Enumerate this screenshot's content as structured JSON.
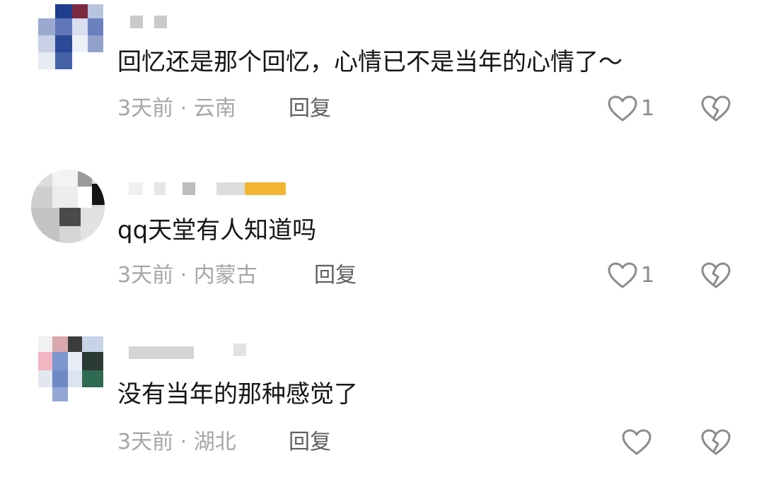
{
  "comments": [
    {
      "text": "回忆还是那个回忆，心情已不是当年的心情了～",
      "time": "3天前",
      "location": "云南",
      "reply_label": "回复",
      "likes": "1"
    },
    {
      "text": "qq天堂有人知道吗",
      "time": "3天前",
      "location": "内蒙古",
      "reply_label": "回复",
      "likes": "1"
    },
    {
      "text": "没有当年的那种感觉了",
      "time": "3天前",
      "location": "湖北",
      "reply_label": "回复",
      "likes": ""
    }
  ],
  "separator": "·",
  "icons": {
    "like": "heart-outline-icon",
    "dislike": "broken-heart-icon"
  },
  "colors": {
    "text": "#161616",
    "meta": "#a6a6a6",
    "reply": "#5f5f5f",
    "icon": "#8b8b8b"
  }
}
